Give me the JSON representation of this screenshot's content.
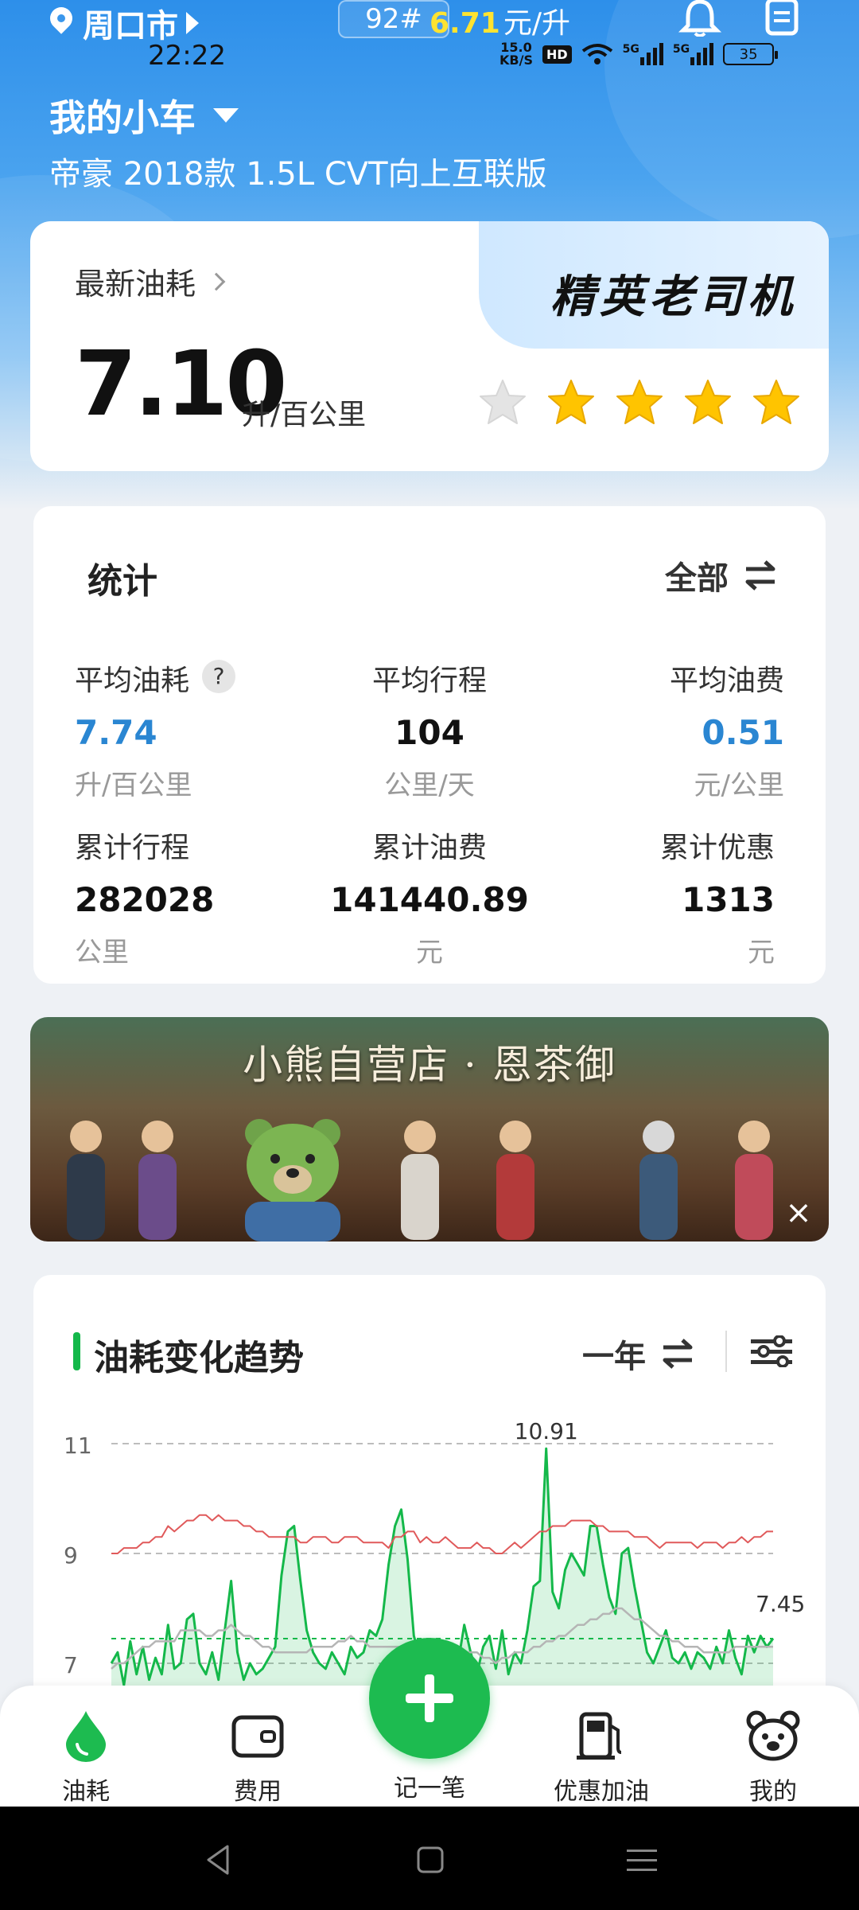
{
  "status": {
    "city": "周口市",
    "fuel_grade": "92#",
    "fuel_price": "6.71",
    "fuel_price_unit": "元/升",
    "time": "22:22",
    "net_speed_value": "15.0",
    "net_speed_unit": "KB/S",
    "hd_label": "HD",
    "signal1_label": "5G",
    "signal2_label": "5G",
    "battery": "35"
  },
  "header": {
    "car_title": "我的小车",
    "car_model": "帝豪 2018款 1.5L CVT向上互联版"
  },
  "latest": {
    "label": "最新油耗",
    "value": "7.10",
    "unit": "升/百公里",
    "rank_badge": "精英老司机",
    "stars_filled": 4,
    "stars_total": 5,
    "star_color": "#ffc400"
  },
  "stats": {
    "title": "统计",
    "filter_label": "全部",
    "help_label": "?",
    "items": [
      {
        "label": "平均油耗",
        "value": "7.74",
        "unit": "升/百公里"
      },
      {
        "label": "平均行程",
        "value": "104",
        "unit": "公里/天"
      },
      {
        "label": "平均油费",
        "value": "0.51",
        "unit": "元/公里"
      },
      {
        "label": "累计行程",
        "value": "282028",
        "unit": "公里"
      },
      {
        "label": "累计油费",
        "value": "141440.89",
        "unit": "元"
      },
      {
        "label": "累计优惠",
        "value": "1313",
        "unit": "元"
      }
    ],
    "accent_color": "#2a86d2"
  },
  "banner": {
    "title": "小熊自营店 · 恩茶御",
    "close_label": "×"
  },
  "trend": {
    "title": "油耗变化趋势",
    "period": "一年",
    "accent_color": "#14b84a"
  },
  "chart_data": {
    "type": "line",
    "y_ticks": [
      "11",
      "9",
      "7"
    ],
    "ylim": [
      6.2,
      11.5
    ],
    "max_label": "10.91",
    "last_label": "7.45",
    "series": [
      {
        "color": "#14b84a",
        "values": [
          7.0,
          7.2,
          6.6,
          7.4,
          6.8,
          7.3,
          6.7,
          7.1,
          6.8,
          7.7,
          6.9,
          7.0,
          7.8,
          7.9,
          7.0,
          6.8,
          7.2,
          6.7,
          7.6,
          8.5,
          7.2,
          6.7,
          7.0,
          6.8,
          6.9,
          7.1,
          7.3,
          8.6,
          9.4,
          9.5,
          8.5,
          7.6,
          7.2,
          7.0,
          6.9,
          7.2,
          7.0,
          6.8,
          7.3,
          7.1,
          7.2,
          7.6,
          7.5,
          7.8,
          8.8,
          9.5,
          9.8,
          8.9,
          7.5,
          7.1,
          7.3,
          7.2,
          7.0,
          7.4,
          7.1,
          7.0,
          7.7,
          7.2,
          6.8,
          7.3,
          7.5,
          6.9,
          7.6,
          6.8,
          7.2,
          7.0,
          7.6,
          8.4,
          8.5,
          10.91,
          8.3,
          8.0,
          8.7,
          9.0,
          8.8,
          8.6,
          9.5,
          9.5,
          8.8,
          8.2,
          7.9,
          9.0,
          9.1,
          8.4,
          7.8,
          7.2,
          7.0,
          7.3,
          7.6,
          7.1,
          7.0,
          7.2,
          6.9,
          7.2,
          7.1,
          6.9,
          7.3,
          7.0,
          7.6,
          7.1,
          6.8,
          7.5,
          7.2,
          7.5,
          7.3,
          7.45
        ]
      },
      {
        "color": "#e0595a",
        "values": [
          9.0,
          9.0,
          9.1,
          9.1,
          9.1,
          9.2,
          9.2,
          9.3,
          9.3,
          9.5,
          9.4,
          9.5,
          9.6,
          9.6,
          9.7,
          9.7,
          9.6,
          9.7,
          9.6,
          9.6,
          9.6,
          9.5,
          9.5,
          9.4,
          9.4,
          9.3,
          9.3,
          9.3,
          9.3,
          9.3,
          9.2,
          9.2,
          9.3,
          9.3,
          9.3,
          9.2,
          9.2,
          9.3,
          9.3,
          9.3,
          9.2,
          9.2,
          9.2,
          9.2,
          9.1,
          9.3,
          9.3,
          9.4,
          9.4,
          9.2,
          9.3,
          9.2,
          9.2,
          9.3,
          9.2,
          9.1,
          9.1,
          9.1,
          9.2,
          9.1,
          9.1,
          9.0,
          9.0,
          9.1,
          9.2,
          9.1,
          9.2,
          9.3,
          9.4,
          9.4,
          9.5,
          9.5,
          9.5,
          9.6,
          9.6,
          9.6,
          9.6,
          9.5,
          9.5,
          9.4,
          9.4,
          9.4,
          9.4,
          9.3,
          9.3,
          9.3,
          9.2,
          9.1,
          9.2,
          9.2,
          9.2,
          9.2,
          9.2,
          9.1,
          9.2,
          9.2,
          9.2,
          9.1,
          9.2,
          9.2,
          9.3,
          9.2,
          9.3,
          9.3,
          9.4,
          9.4
        ]
      },
      {
        "color": "#b5b5b5",
        "values": [
          6.9,
          7.0,
          7.0,
          7.1,
          7.2,
          7.3,
          7.3,
          7.4,
          7.4,
          7.4,
          7.4,
          7.6,
          7.6,
          7.6,
          7.6,
          7.5,
          7.5,
          7.6,
          7.6,
          7.7,
          7.6,
          7.5,
          7.5,
          7.4,
          7.3,
          7.3,
          7.2,
          7.2,
          7.2,
          7.2,
          7.2,
          7.2,
          7.3,
          7.3,
          7.3,
          7.3,
          7.4,
          7.4,
          7.5,
          7.4,
          7.4,
          7.3,
          7.3,
          7.3,
          7.3,
          7.3,
          7.3,
          7.3,
          7.3,
          7.3,
          7.2,
          7.3,
          7.2,
          7.1,
          7.1,
          7.1,
          7.2,
          7.2,
          7.2,
          7.1,
          7.1,
          7.0,
          7.1,
          7.1,
          7.2,
          7.2,
          7.2,
          7.3,
          7.3,
          7.4,
          7.4,
          7.5,
          7.5,
          7.6,
          7.7,
          7.7,
          7.8,
          7.8,
          7.9,
          7.9,
          8.0,
          8.0,
          7.9,
          7.8,
          7.8,
          7.7,
          7.6,
          7.5,
          7.5,
          7.4,
          7.4,
          7.3,
          7.3,
          7.3,
          7.2,
          7.2,
          7.2,
          7.2,
          7.2,
          7.3,
          7.3,
          7.3,
          7.3,
          7.3,
          7.3,
          7.3
        ]
      }
    ]
  },
  "nav": {
    "items": [
      {
        "label": "油耗",
        "icon": "drop-icon"
      },
      {
        "label": "费用",
        "icon": "wallet-icon"
      },
      {
        "label": "优惠加油",
        "icon": "gas-pump-icon"
      },
      {
        "label": "我的",
        "icon": "bear-icon"
      }
    ],
    "fab_label": "记一笔"
  }
}
